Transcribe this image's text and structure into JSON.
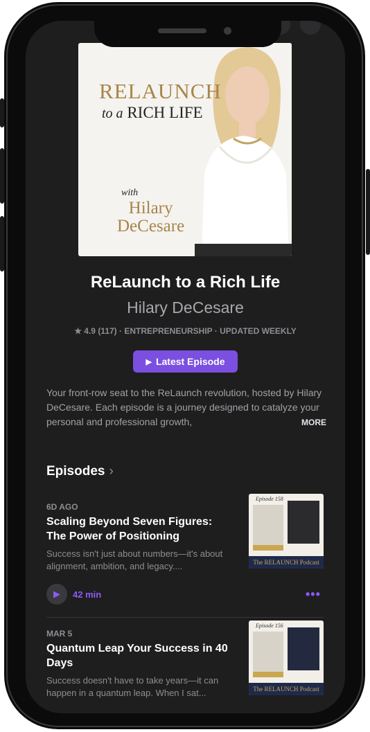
{
  "podcast": {
    "cover": {
      "line1": "RELAUNCH",
      "line2_small": "to a",
      "line2": "RICH LIFE",
      "with": "with",
      "host_first": "Hilary",
      "host_last": "DeCesare"
    },
    "title": "ReLaunch to a Rich Life",
    "artist": "Hilary DeCesare",
    "meta": "4.9 (117) · ENTREPRENEURSHIP · UPDATED WEEKLY",
    "latest_button": "Latest Episode",
    "description": "Your front-row seat to the ReLaunch revolution, hosted by Hilary DeCesare. Each episode is a journey designed to catalyze your personal and professional growth,",
    "more_label": "MORE"
  },
  "episodes": {
    "heading": "Episodes",
    "items": [
      {
        "date": "6D AGO",
        "title": "Scaling Beyond Seven Figures: The Power of Positioning",
        "description": "Success isn't just about numbers—it's about alignment, ambition, and legacy....",
        "duration": "42 min",
        "thumb_label": "Episode 158",
        "thumb_band": "The RELAUNCH Podcast"
      },
      {
        "date": "MAR 5",
        "title": "Quantum Leap Your Success in 40 Days",
        "description": "Success doesn't have to take years—it can happen in a quantum leap. When I sat...",
        "thumb_label": "Episode 156",
        "thumb_band": "The RELAUNCH Podcast"
      }
    ]
  },
  "colors": {
    "accent": "#7b4fe0",
    "background": "#1e1e1f",
    "gold": "#a7854a"
  }
}
